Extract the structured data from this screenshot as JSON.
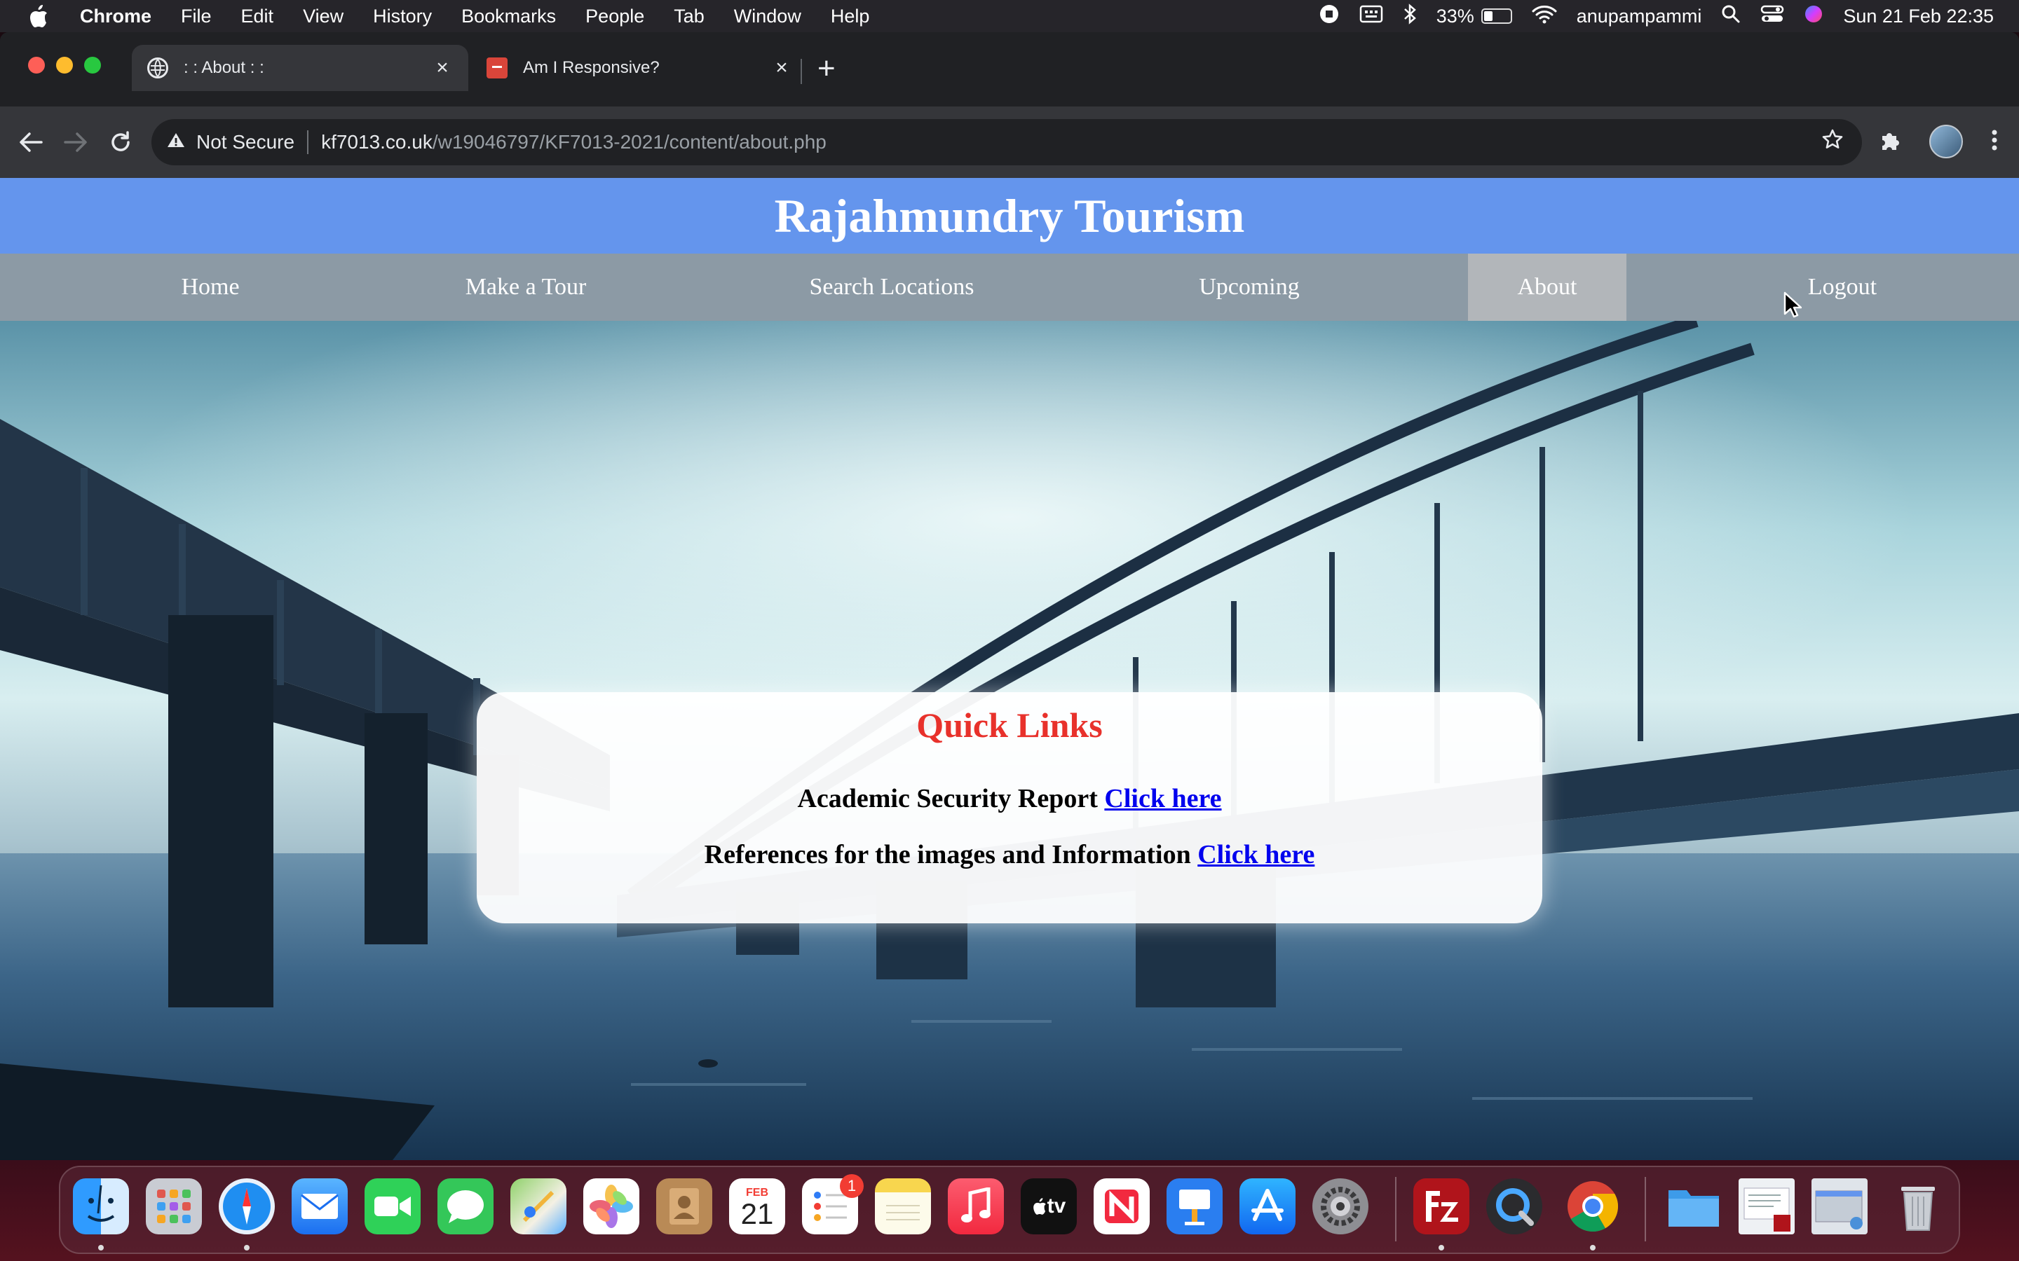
{
  "menubar": {
    "app_name": "Chrome",
    "items": [
      "File",
      "Edit",
      "View",
      "History",
      "Bookmarks",
      "People",
      "Tab",
      "Window",
      "Help"
    ],
    "battery_percent": "33%",
    "battery_level": 0.33,
    "username": "anupampammi",
    "datetime": "Sun 21 Feb  22:35"
  },
  "browser": {
    "tabs": [
      {
        "title": ": : About : :",
        "active": true
      },
      {
        "title": "Am I Responsive?",
        "active": false
      }
    ],
    "security_label": "Not Secure",
    "url_host": "kf7013.co.uk",
    "url_path": "/w19046797/KF7013-2021/content/about.php"
  },
  "site": {
    "title": "Rajahmundry Tourism",
    "nav": [
      "Home",
      "Make a Tour",
      "Search Locations",
      "Upcoming",
      "About",
      "Logout"
    ],
    "active_nav": "About"
  },
  "quick_links": {
    "heading": "Quick Links",
    "rows": [
      {
        "text": "Academic Security Report ",
        "link": "Click here"
      },
      {
        "text": "References for the images and Information ",
        "link": "Click here"
      }
    ]
  },
  "dock": {
    "calendar_month": "FEB",
    "calendar_day": "21",
    "reminders_badge": "1",
    "appletv_label": "tv"
  }
}
